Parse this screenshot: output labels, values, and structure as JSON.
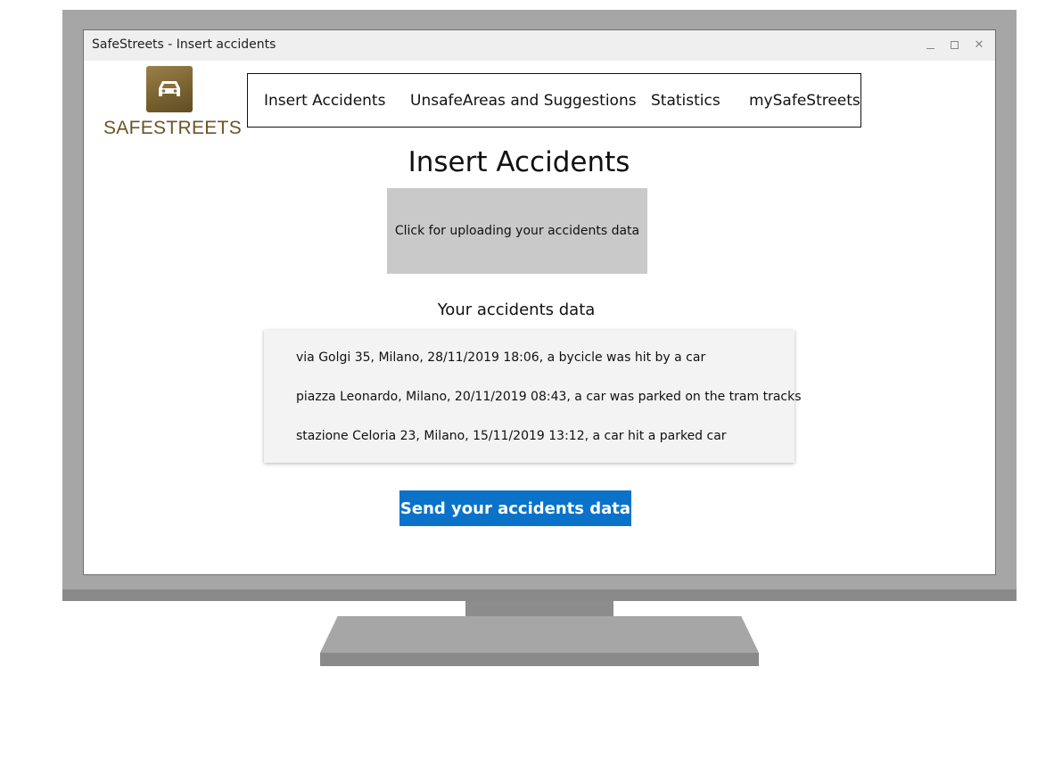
{
  "window": {
    "title": "SafeStreets - Insert accidents"
  },
  "logo": {
    "text": "SAFESTREETS",
    "icon": "car-icon"
  },
  "nav": {
    "items": [
      {
        "label": "Insert Accidents"
      },
      {
        "label": "UnsafeAreas and Suggestions"
      },
      {
        "label": "Statistics"
      },
      {
        "label": "mySafeStreets"
      }
    ]
  },
  "main": {
    "title": "Insert Accidents",
    "upload_label": "Click for uploading your accidents data",
    "data_title": "Your accidents data",
    "accidents": [
      "via Golgi 35, Milano, 28/11/2019 18:06, a bycicle was hit by a car",
      "piazza Leonardo, Milano, 20/11/2019 08:43, a car was parked on the tram tracks",
      "stazione Celoria 23, Milano, 15/11/2019 13:12, a car hit a parked car"
    ],
    "send_label": "Send your accidents data"
  },
  "colors": {
    "accent": "#0a73c9",
    "logo_gold": "#7a6331",
    "upload_bg": "#c9c9c9"
  }
}
